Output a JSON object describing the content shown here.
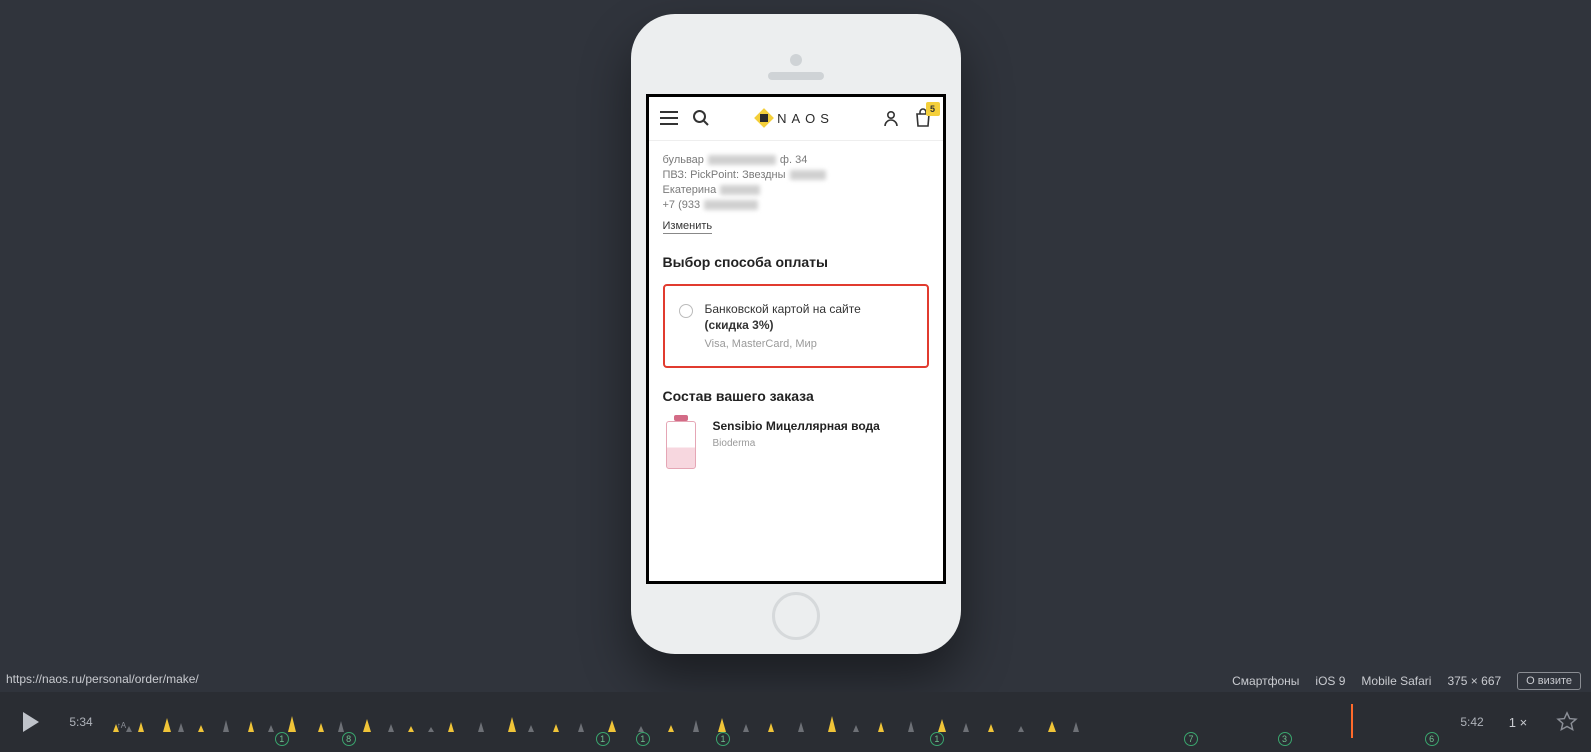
{
  "url": "https://naos.ru/personal/order/make/",
  "meta": {
    "device": "Смартфоны",
    "os": "iOS 9",
    "browser": "Mobile Safari",
    "viewport": "375 × 667",
    "about_btn": "О визите"
  },
  "app": {
    "logo_text": "NAOS",
    "cart_count": "5",
    "address": {
      "line1_prefix": "бульвар",
      "line1_suffix": "ф. 34",
      "line2_prefix": "ПВЗ: PickPoint: Звездны",
      "line3_prefix": "Екатерина",
      "line4_prefix": "+7 (933"
    },
    "change_link": "Изменить",
    "payment_title": "Выбор способа оплаты",
    "payment_option": {
      "title": "Банковской картой на сайте",
      "discount": "(скидка 3%)",
      "subtitle": "Visa, MasterCard, Мир"
    },
    "order_title": "Состав вашего заказа",
    "product": {
      "name": "Sensibio Мицеллярная вода",
      "brand": "Bioderma"
    }
  },
  "player": {
    "time_start": "5:34",
    "time_end": "5:42",
    "speed": "1 ×",
    "cursor_percent": 93,
    "markers": [
      {
        "label": "1",
        "pos": 13
      },
      {
        "label": "8",
        "pos": 18
      },
      {
        "label": "1",
        "pos": 37
      },
      {
        "label": "1",
        "pos": 40
      },
      {
        "label": "1",
        "pos": 46
      },
      {
        "label": "1",
        "pos": 62
      },
      {
        "label": "7",
        "pos": 81
      },
      {
        "label": "3",
        "pos": 88
      },
      {
        "label": "6",
        "pos": 99
      }
    ]
  }
}
